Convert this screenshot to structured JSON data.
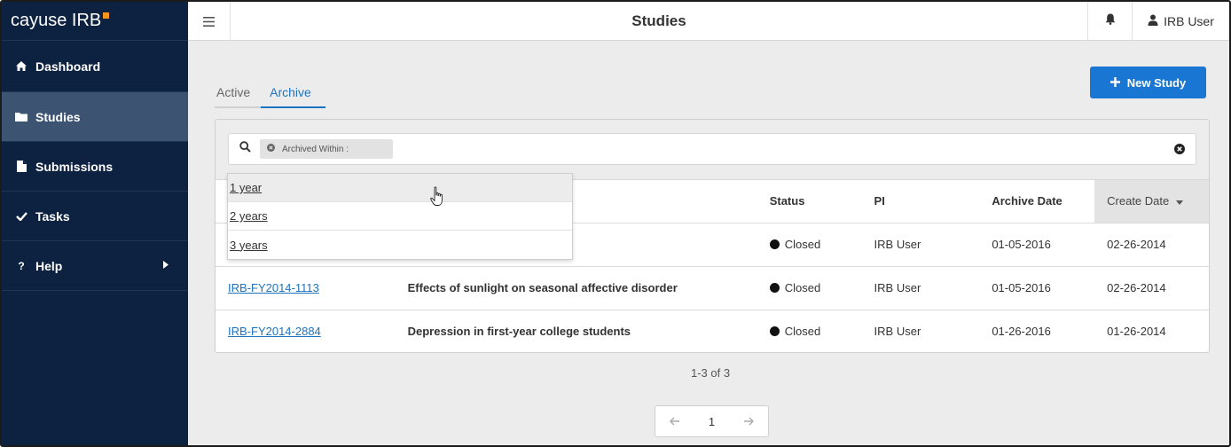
{
  "brand": {
    "name": "cayuse IRB"
  },
  "sidebar": {
    "items": [
      {
        "label": "Dashboard",
        "icon": "home-icon"
      },
      {
        "label": "Studies",
        "icon": "folder-icon",
        "active": true
      },
      {
        "label": "Submissions",
        "icon": "file-icon"
      },
      {
        "label": "Tasks",
        "icon": "check-icon"
      },
      {
        "label": "Help",
        "icon": "question-icon"
      }
    ]
  },
  "header": {
    "title": "Studies",
    "user_name": "IRB User"
  },
  "tabs": [
    {
      "label": "Active",
      "active": false
    },
    {
      "label": "Archive",
      "active": true
    }
  ],
  "toolbar": {
    "new_study_label": "New Study"
  },
  "search": {
    "chip_label": "Archived Within :"
  },
  "dropdown": {
    "options": [
      "1 year",
      "2 years",
      "3 years"
    ]
  },
  "table": {
    "columns": [
      "",
      "",
      "Status",
      "PI",
      "Archive Date",
      "Create Date"
    ],
    "rows": [
      {
        "id": "",
        "title": "",
        "status": "Closed",
        "pi": "IRB User",
        "archive_date": "01-05-2016",
        "create_date": "02-26-2014"
      },
      {
        "id": "IRB-FY2014-1113",
        "title": "Effects of sunlight on seasonal affective disorder",
        "status": "Closed",
        "pi": "IRB User",
        "archive_date": "01-05-2016",
        "create_date": "02-26-2014"
      },
      {
        "id": "IRB-FY2014-2884",
        "title": "Depression in first-year college students",
        "status": "Closed",
        "pi": "IRB User",
        "archive_date": "01-26-2016",
        "create_date": "01-26-2014"
      }
    ]
  },
  "pagination": {
    "summary": "1-3 of 3",
    "current_page": "1"
  },
  "colors": {
    "sidebar_bg": "#0d2240",
    "sidebar_active": "#3c5471",
    "accent": "#1976d2",
    "brand_dot": "#f7941d"
  }
}
